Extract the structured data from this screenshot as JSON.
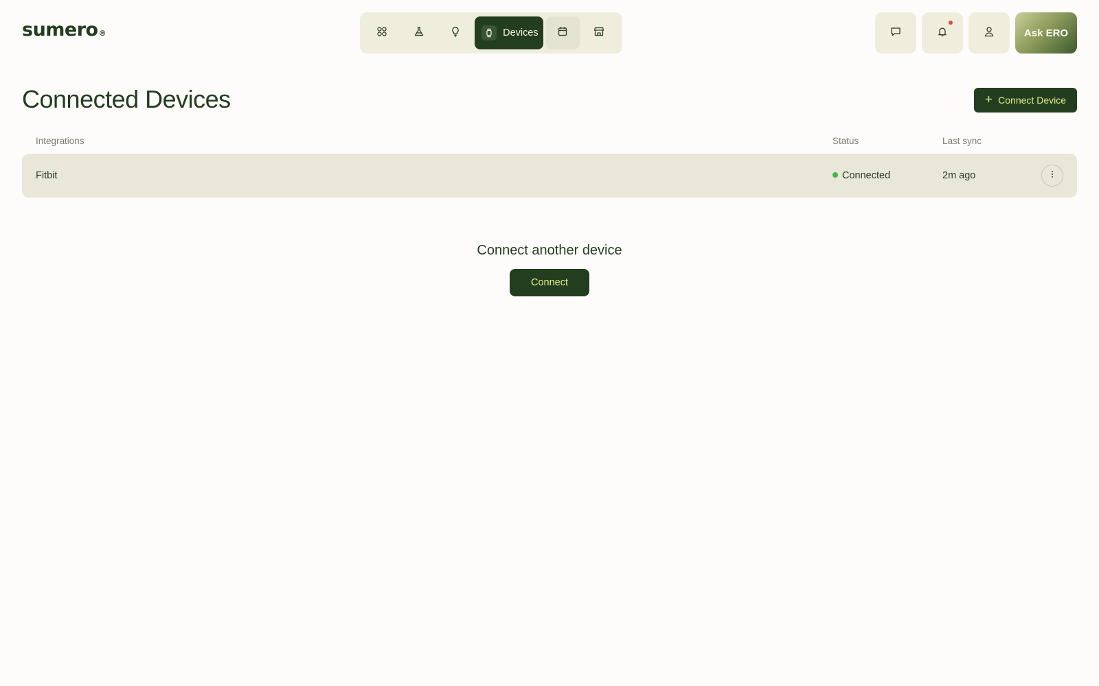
{
  "app": {
    "logo": "sumero",
    "logo_mark": "®"
  },
  "nav": {
    "items": [
      {
        "icon": "apps-icon",
        "label": ""
      },
      {
        "icon": "flask-icon",
        "label": ""
      },
      {
        "icon": "lightbulb-icon",
        "label": ""
      },
      {
        "icon": "watch-icon",
        "label": "Devices",
        "active": true
      },
      {
        "icon": "calendar-icon",
        "label": ""
      },
      {
        "icon": "store-icon",
        "label": ""
      }
    ]
  },
  "top_actions": {
    "messages_icon": "chat-icon",
    "notifications_icon": "bell-icon",
    "has_unread_notifications": true,
    "profile_icon": "user-icon",
    "ask_label": "Ask ERO"
  },
  "page": {
    "title": "Connected Devices",
    "connect_device_label": "Connect Device"
  },
  "table": {
    "headers": {
      "integrations": "Integrations",
      "status": "Status",
      "last_sync": "Last sync"
    },
    "rows": [
      {
        "name": "Fitbit",
        "status": "Connected",
        "status_color": "#42b848",
        "last_sync": "2m ago"
      }
    ]
  },
  "empty_cta": {
    "title": "Connect another device",
    "button_label": "Connect"
  },
  "colors": {
    "primary": "#233d1f",
    "accent_text": "#e6ef8a",
    "surface": "#efeedd",
    "row_bg": "#e9e8d8"
  }
}
